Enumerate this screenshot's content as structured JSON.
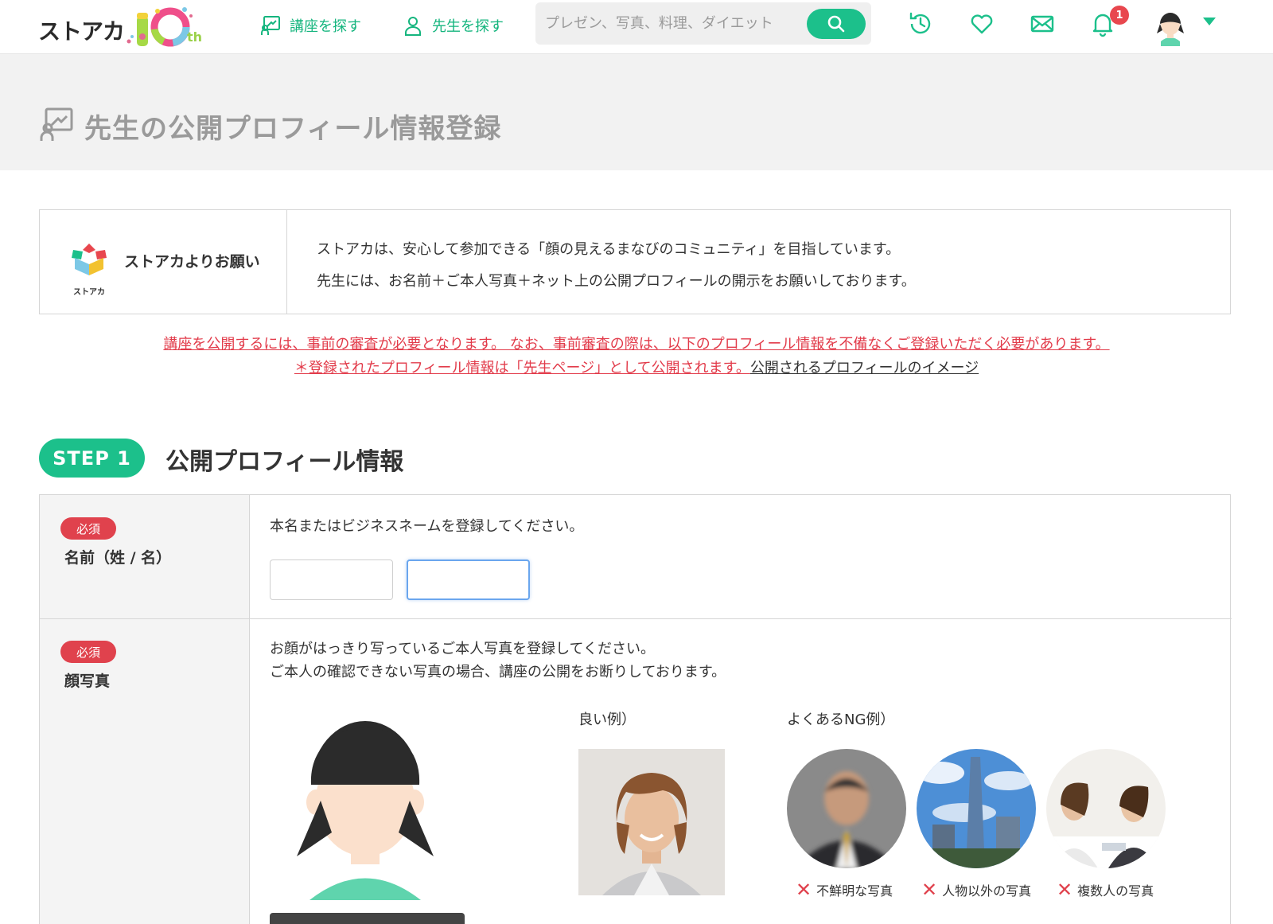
{
  "header": {
    "logo_text": "ストアカ",
    "logo_anniv": "10",
    "logo_suffix": "th",
    "nav_courses": "講座を探す",
    "nav_teachers": "先生を探す",
    "search_placeholder": "プレゼン、写真、料理、ダイエット",
    "notification_count": "1",
    "colors": {
      "accent": "#1cc08b",
      "badge": "#e8474e"
    }
  },
  "page": {
    "title": "先生の公開プロフィール情報登録"
  },
  "request": {
    "label": "ストアカよりお願い",
    "logo_caption": "ストアカ",
    "line1": "ストアカは、安心して参加できる「顔の見えるまなびのコミュニティ」を目指しています。",
    "line2": "先生には、お名前＋ご本人写真＋ネット上の公開プロフィールの開示をお願いしております。"
  },
  "notice": {
    "line1": "講座を公開するには、事前の審査が必要となります。 なお、事前審査の際は、以下のプロフィール情報を不備なくご登録いただく必要があります。",
    "line2_red": "＊登録されたプロフィール情報は「先生ページ」として公開されます。",
    "line2_link": "公開されるプロフィールのイメージ"
  },
  "step": {
    "pill": "STEP 1",
    "title": "公開プロフィール情報"
  },
  "form": {
    "required_badge": "必須",
    "name": {
      "label": "名前（姓 / 名）",
      "help": "本名またはビジネスネームを登録してください。",
      "last_value": "",
      "first_value": ""
    },
    "photo": {
      "label": "顔写真",
      "help1": "お顔がはっきり写っているご本人写真を登録してください。",
      "help2": "ご本人の確認できない写真の場合、講座の公開をお断りしております。",
      "good_label": "良い例）",
      "ng_label": "よくあるNG例）",
      "ng_items": [
        {
          "caption": "不鮮明な写真"
        },
        {
          "caption": "人物以外の写真"
        },
        {
          "caption": "複数人の写真"
        }
      ]
    }
  }
}
